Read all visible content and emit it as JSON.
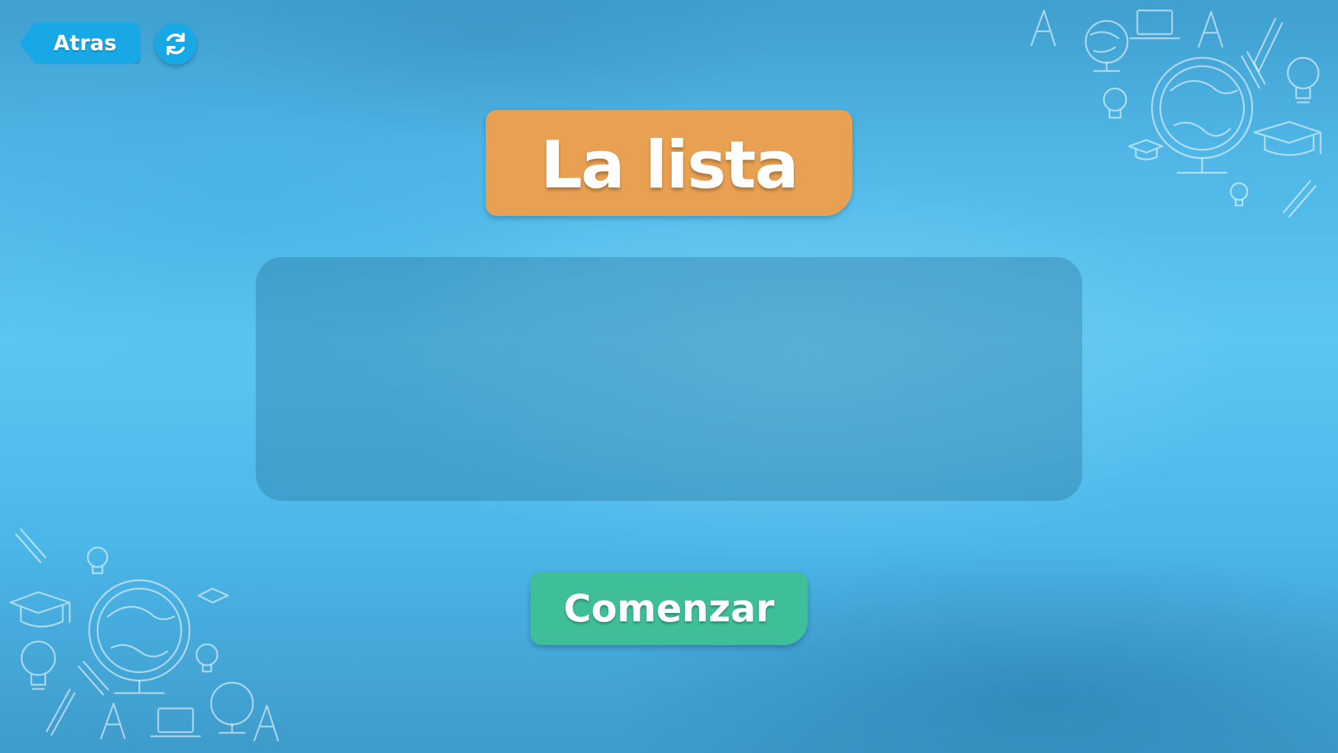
{
  "header": {
    "back_label": "Atras",
    "back_icon": "chevron-left-icon",
    "reload_icon": "reload-icon"
  },
  "title": {
    "text": "La lista"
  },
  "content": {
    "items": []
  },
  "actions": {
    "start_label": "Comenzar"
  },
  "colors": {
    "button_blue": "#18a8e6",
    "title_orange": "#e8a153",
    "start_green": "#3fbf99",
    "background_blue": "#4fb6e6"
  },
  "decorations": {
    "doodle_icons": [
      "letter-a-icon",
      "globe-icon",
      "laptop-icon",
      "pencil-icon",
      "light-bulb-icon",
      "graduation-cap-icon"
    ]
  }
}
